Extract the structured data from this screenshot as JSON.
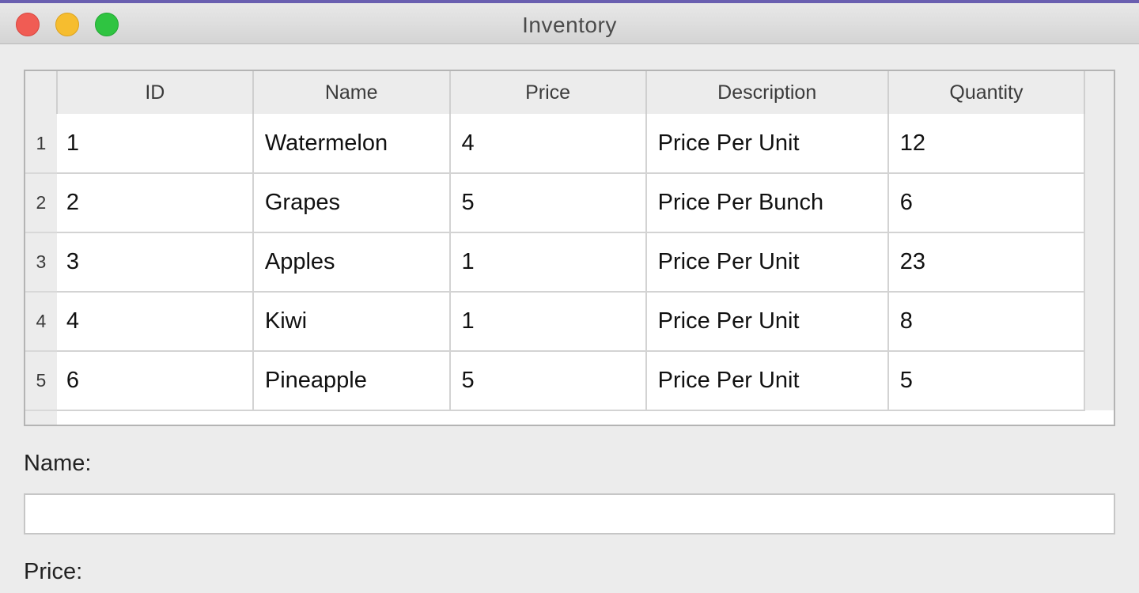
{
  "window": {
    "title": "Inventory"
  },
  "table": {
    "columns": [
      "ID",
      "Name",
      "Price",
      "Description",
      "Quantity"
    ],
    "rows": [
      {
        "row_number": "1",
        "id": "1",
        "name": "Watermelon",
        "price": "4",
        "description": "Price Per Unit",
        "quantity": "12"
      },
      {
        "row_number": "2",
        "id": "2",
        "name": "Grapes",
        "price": "5",
        "description": "Price Per Bunch",
        "quantity": "6"
      },
      {
        "row_number": "3",
        "id": "3",
        "name": "Apples",
        "price": "1",
        "description": "Price Per Unit",
        "quantity": "23"
      },
      {
        "row_number": "4",
        "id": "4",
        "name": "Kiwi",
        "price": "1",
        "description": "Price Per Unit",
        "quantity": "8"
      },
      {
        "row_number": "5",
        "id": "6",
        "name": "Pineapple",
        "price": "5",
        "description": "Price Per Unit",
        "quantity": "5"
      }
    ]
  },
  "form": {
    "name_label": "Name:",
    "name_value": "",
    "price_label": "Price:"
  }
}
